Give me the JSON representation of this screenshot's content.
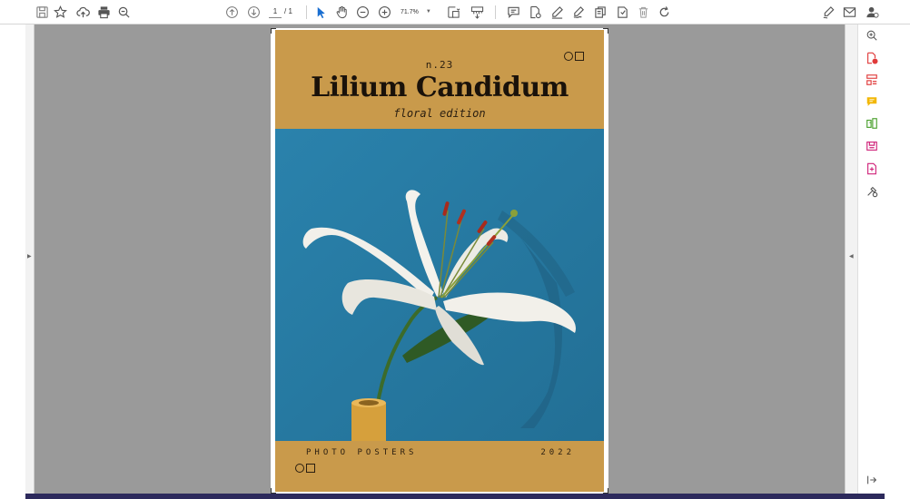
{
  "toolbar": {
    "page_current": "1",
    "page_total": "/ 1",
    "zoom": "71.7%",
    "left_tools": [
      "save-icon",
      "bookmark-star-icon",
      "cloud-upload-icon",
      "print-icon",
      "search-icon"
    ],
    "nav_tools": [
      "previous-page-icon",
      "next-page-icon"
    ],
    "edit_tools": [
      "select-arrow-icon",
      "hand-pan-icon",
      "zoom-out-icon",
      "zoom-in-icon"
    ],
    "view_tools": [
      "fit-page-icon",
      "scroll-mode-icon"
    ],
    "annotate_tools": [
      "comment-icon",
      "stamp-icon",
      "pen-icon",
      "sign-icon",
      "copy-text-icon",
      "read-aloud-icon",
      "delete-icon",
      "rotate-icon"
    ],
    "right_tools": [
      "fill-sign-icon",
      "email-icon",
      "account-icon"
    ]
  },
  "cover": {
    "issue": "n.23",
    "title": "Lilium Candidum",
    "subtitle": "floral edition",
    "footer_left": "PHOTO POSTERS",
    "footer_right": "2022",
    "color_background": "#c99a4b",
    "color_photo": "#2b7ea6"
  },
  "side_panel": {
    "tools": [
      "zoom-panel-icon",
      "create-pdf-icon",
      "organize-pages-icon",
      "comment-panel-icon",
      "combine-files-icon",
      "export-pdf-icon",
      "edit-pdf-icon",
      "more-tools-icon"
    ],
    "collapse": "panel-collapse-icon"
  }
}
